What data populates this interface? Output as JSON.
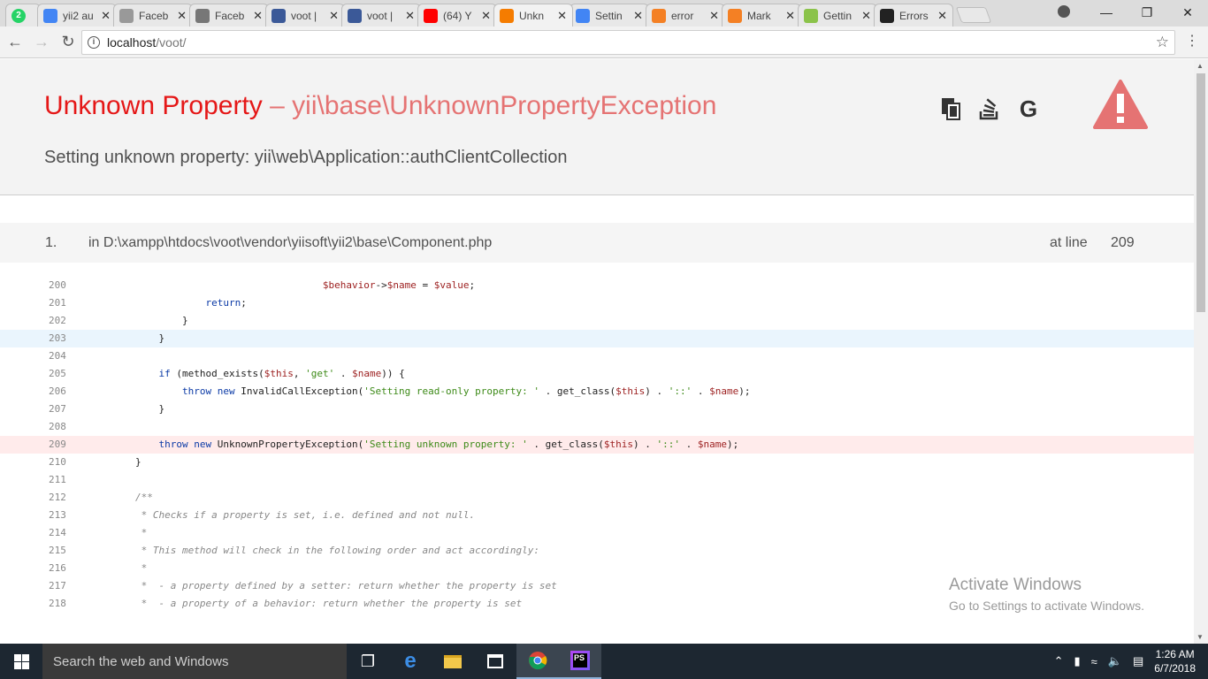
{
  "browser": {
    "tabs": [
      {
        "label": "2",
        "favicon": "whatsapp-icon",
        "color": "#25d366"
      },
      {
        "label": "yii2 au",
        "favicon": "google-icon",
        "color": "#4285f4"
      },
      {
        "label": "Faceb",
        "favicon": "page-icon",
        "color": "#999999"
      },
      {
        "label": "Faceb",
        "favicon": "link-icon",
        "color": "#777777"
      },
      {
        "label": "voot |",
        "favicon": "facebook-icon",
        "color": "#3b5998"
      },
      {
        "label": "voot |",
        "favicon": "facebook-icon",
        "color": "#3b5998"
      },
      {
        "label": "(64) Y",
        "favicon": "youtube-icon",
        "color": "#ff0000"
      },
      {
        "label": "Unkn",
        "favicon": "yii-error-icon",
        "color": "#f57c00"
      },
      {
        "label": "Settin",
        "favicon": "google-icon",
        "color": "#4285f4"
      },
      {
        "label": "error",
        "favicon": "stackoverflow-icon",
        "color": "#f48024"
      },
      {
        "label": "Mark",
        "favicon": "stackoverflow-icon",
        "color": "#f48024"
      },
      {
        "label": "Gettin",
        "favicon": "yii-icon",
        "color": "#8bc34a"
      },
      {
        "label": "Errors",
        "favicon": "github-icon",
        "color": "#222222"
      }
    ],
    "url_host": "localhost",
    "url_path": "/voot/"
  },
  "error": {
    "title": "Unknown Property",
    "dash": " – ",
    "exception_class": "yii\\base\\UnknownPropertyException",
    "message": "Setting unknown property: yii\\web\\Application::authClientCollection"
  },
  "call": {
    "number": "1.",
    "file_prefix": "in ",
    "file": "D:\\xampp\\htdocs\\voot\\vendor\\yiisoft\\yii2\\base\\Component.php",
    "at_line_label": "at line",
    "line": "209"
  },
  "code_lines": [
    {
      "n": "200",
      "t": "                                        $behavior->$name = $value;"
    },
    {
      "n": "201",
      "t": "                    return;"
    },
    {
      "n": "202",
      "t": "                }"
    },
    {
      "n": "203",
      "t": "            }"
    },
    {
      "n": "204",
      "t": ""
    },
    {
      "n": "205",
      "t": "            if (method_exists($this, 'get' . $name)) {"
    },
    {
      "n": "206",
      "t": "                throw new InvalidCallException('Setting read-only property: ' . get_class($this) . '::' . $name);"
    },
    {
      "n": "207",
      "t": "            }"
    },
    {
      "n": "208",
      "t": ""
    },
    {
      "n": "209",
      "t": "            throw new UnknownPropertyException('Setting unknown property: ' . get_class($this) . '::' . $name);"
    },
    {
      "n": "210",
      "t": "        }"
    },
    {
      "n": "211",
      "t": ""
    },
    {
      "n": "212",
      "t": "        /**"
    },
    {
      "n": "213",
      "t": "         * Checks if a property is set, i.e. defined and not null."
    },
    {
      "n": "214",
      "t": "         *"
    },
    {
      "n": "215",
      "t": "         * This method will check in the following order and act accordingly:"
    },
    {
      "n": "216",
      "t": "         *"
    },
    {
      "n": "217",
      "t": "         *  - a property defined by a setter: return whether the property is set"
    },
    {
      "n": "218",
      "t": "         *  - a property of a behavior: return whether the property is set"
    }
  ],
  "watermark": {
    "line1": "Activate Windows",
    "line2": "Go to Settings to activate Windows."
  },
  "taskbar": {
    "search_placeholder": "Search the web and Windows",
    "time": "1:26 AM",
    "date": "6/7/2018"
  }
}
